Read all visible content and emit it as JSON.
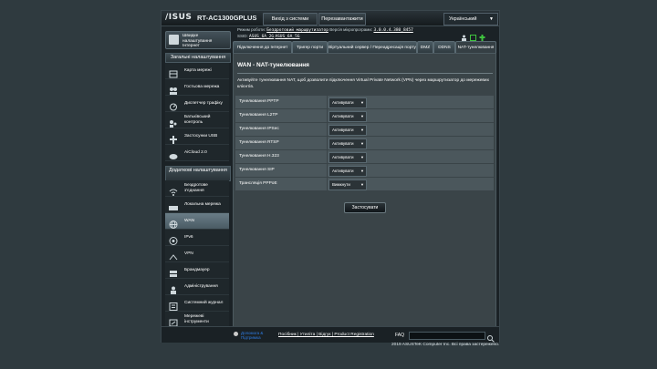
{
  "header": {
    "logo": "/ISUS",
    "model": "RT-AC1300GPLUS",
    "logout_label": "Вихід з системи",
    "reboot_label": "Перезавантажити",
    "language": "Український",
    "mode_label": "Режим роботи:",
    "mode_value": "Бездротовий маршрутизатор",
    "firmware_label": "Версія мікропрограми:",
    "firmware_value": "3.0.0.4.380_8457",
    "ssid_label": "SSID:",
    "ssid_1": "ASUS_6A_2G",
    "ssid_2": "ASUS_6A_5G"
  },
  "sidebar": {
    "quick_setup": "Швидке налаштування Інтернет",
    "general_head": "Загальні налаштування",
    "general_items": [
      {
        "label": "Карта мережі",
        "icon": "network-map-icon"
      },
      {
        "label": "Гостьова мережа",
        "icon": "guest-network-icon"
      },
      {
        "label": "Диспетчер трафіку",
        "icon": "traffic-manager-icon"
      },
      {
        "label": "Батьківський контроль",
        "icon": "parental-control-icon"
      },
      {
        "label": "Застосунки USB",
        "icon": "usb-icon"
      },
      {
        "label": "AiCloud 2.0",
        "icon": "cloud-icon"
      }
    ],
    "advanced_head": "Додаткові налаштування",
    "advanced_items": [
      {
        "label": "Бездротове з'єднання",
        "icon": "wireless-icon"
      },
      {
        "label": "Локальна мережа",
        "icon": "lan-icon"
      },
      {
        "label": "WAN",
        "icon": "globe-icon"
      },
      {
        "label": "IPv6",
        "icon": "ipv6-icon"
      },
      {
        "label": "VPN",
        "icon": "vpn-icon"
      },
      {
        "label": "Брандмауер",
        "icon": "firewall-icon"
      },
      {
        "label": "Адміністрування",
        "icon": "admin-icon"
      },
      {
        "label": "Системний журнал",
        "icon": "syslog-icon"
      },
      {
        "label": "Мережеві інструменти",
        "icon": "tools-icon"
      }
    ]
  },
  "tabs": [
    {
      "label": "Підключення до Інтернет"
    },
    {
      "label": "Тригер порти"
    },
    {
      "label": "Віртуальний сервер / Переадресація порту"
    },
    {
      "label": "DMZ"
    },
    {
      "label": "DDNS"
    },
    {
      "label": "NAT-тунелювання"
    }
  ],
  "main": {
    "title": "WAN - NAT-тунелювання",
    "description": "Активуйте тунелювання NAT, щоб дозволити підключення Virtual Private Network (VPN) через маршрутизатор до мережевих клієнтів.",
    "rows": [
      {
        "label": "Тунелювання PPTP",
        "value": "Активувати"
      },
      {
        "label": "Тунелювання L2TP",
        "value": "Активувати"
      },
      {
        "label": "Тунелювання IPSec",
        "value": "Активувати"
      },
      {
        "label": "Тунелювання RTSP",
        "value": "Активувати"
      },
      {
        "label": "Тунелювання H.323",
        "value": "Активувати"
      },
      {
        "label": "Тунелювання SIP",
        "value": "Активувати"
      },
      {
        "label": "Трансляція PPPoE",
        "value": "Вимкнути"
      }
    ],
    "apply_label": "Застосувати"
  },
  "footer": {
    "help": "Допомога & Підтримка",
    "links": "Посібник | Утиліта | Відгук | Product Registration",
    "faq": "FAQ",
    "copyright": "2019 ASUSTeK Computer Inc. Всі права застережено."
  }
}
